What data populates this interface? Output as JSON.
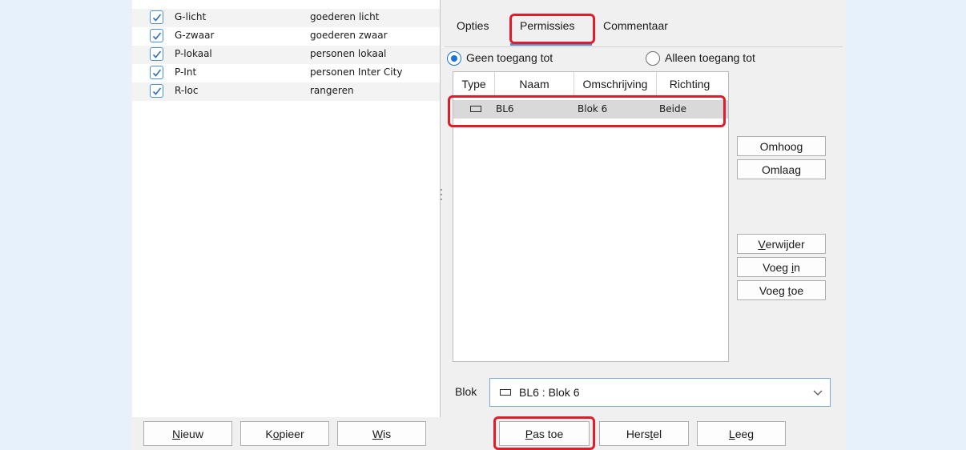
{
  "list": {
    "items": [
      {
        "code": "G-licht",
        "description": "goederen licht",
        "checked": true
      },
      {
        "code": "G-zwaar",
        "description": "goederen zwaar",
        "checked": true
      },
      {
        "code": "P-lokaal",
        "description": "personen lokaal",
        "checked": true
      },
      {
        "code": "P-Int",
        "description": "personen Inter City",
        "checked": true
      },
      {
        "code": "R-loc",
        "description": "rangeren",
        "checked": true
      }
    ]
  },
  "left_buttons": {
    "new": {
      "pre": "",
      "u": "N",
      "post": "ieuw"
    },
    "copy": {
      "pre": "K",
      "u": "o",
      "post": "pieer"
    },
    "delete": {
      "pre": "",
      "u": "W",
      "post": "is"
    }
  },
  "tabs": [
    {
      "label": "Opties",
      "active": false
    },
    {
      "label": "Permissies",
      "active": true
    },
    {
      "label": "Commentaar",
      "active": false
    }
  ],
  "access": {
    "option_none": "Geen toegang tot",
    "option_only": "Alleen toegang tot",
    "selected": "option_none"
  },
  "table": {
    "headers": [
      "Type",
      "Naam",
      "Omschrijving",
      "Richting"
    ],
    "rows": [
      {
        "type_icon": "rectangle-icon",
        "name": "BL6",
        "description": "Blok 6",
        "direction": "Beide"
      }
    ]
  },
  "side_buttons": {
    "up": "Omhoog",
    "down": "Omlaag",
    "remove": {
      "pre": "",
      "u": "V",
      "post": "erwijder"
    },
    "insert": {
      "pre": "Voeg ",
      "u": "i",
      "post": "n"
    },
    "add": {
      "pre": "Voeg ",
      "u": "t",
      "post": "oe"
    }
  },
  "block": {
    "label": "Blok",
    "value": "BL6 : Blok 6",
    "icon": "rectangle-icon"
  },
  "bottom_buttons": {
    "apply": {
      "pre": "",
      "u": "P",
      "post": "as toe"
    },
    "reset": {
      "pre": "Hers",
      "u": "t",
      "post": "el"
    },
    "clear": {
      "pre": "",
      "u": "L",
      "post": "eeg"
    }
  },
  "colors": {
    "highlight": "#e01e2b",
    "accent": "#1a73d8",
    "band": "#e7f1fb"
  }
}
